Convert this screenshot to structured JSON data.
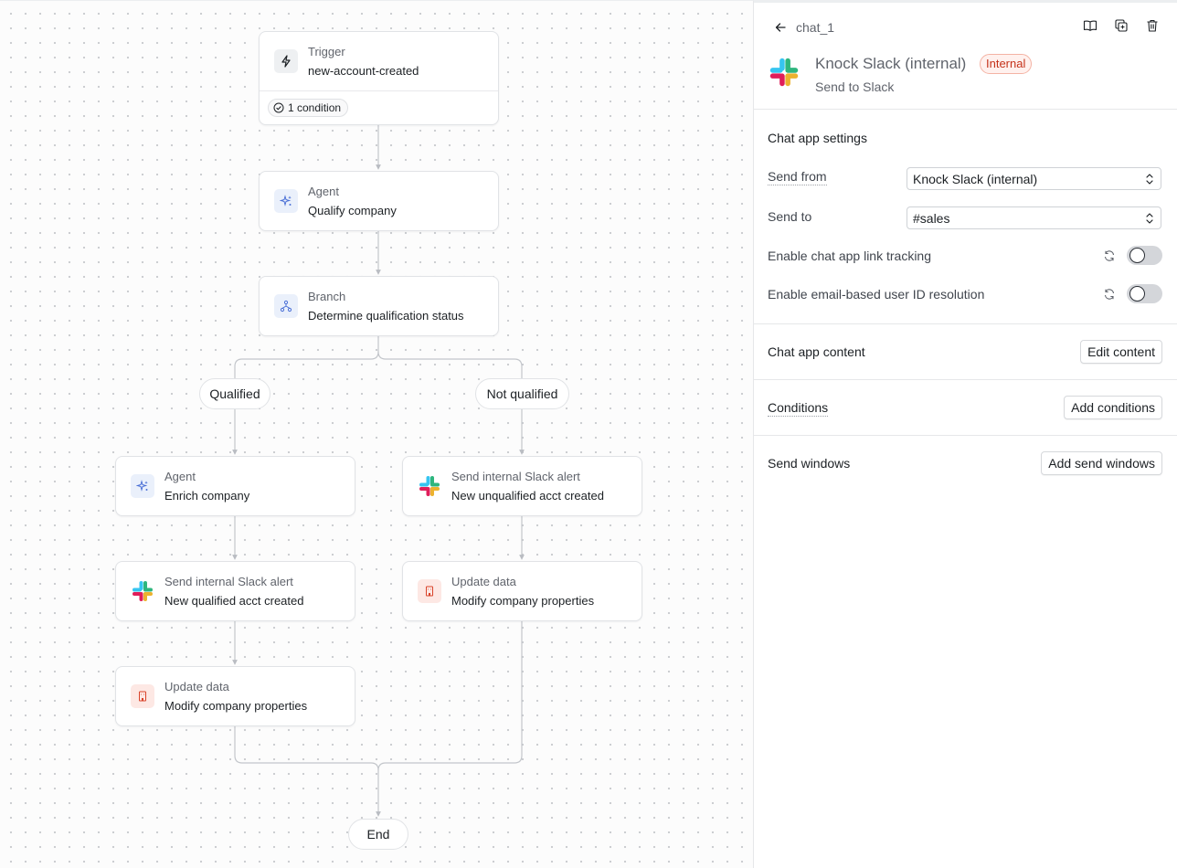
{
  "canvas": {
    "trigger": {
      "kind": "Trigger",
      "title": "new-account-created",
      "condition": "1 condition"
    },
    "agent_qualify": {
      "kind": "Agent",
      "title": "Qualify company"
    },
    "branch": {
      "kind": "Branch",
      "title": "Determine qualification status"
    },
    "branch_labels": {
      "left": "Qualified",
      "right": "Not qualified"
    },
    "agent_enrich": {
      "kind": "Agent",
      "title": "Enrich company"
    },
    "slack_left": {
      "kind": "Send internal Slack alert",
      "title": "New qualified acct created"
    },
    "update_left": {
      "kind": "Update data",
      "title": "Modify company properties"
    },
    "slack_right": {
      "kind": "Send internal Slack alert",
      "title": "New unqualified acct created"
    },
    "update_right": {
      "kind": "Update data",
      "title": "Modify company properties"
    },
    "end": "End"
  },
  "panel": {
    "step_key": "chat_1",
    "channel_name": "Knock Slack (internal)",
    "badge": "Internal",
    "channel_sub": "Send to Slack",
    "settings": {
      "title": "Chat app settings",
      "send_from_label": "Send from",
      "send_from_value": "Knock Slack (internal)",
      "send_to_label": "Send to",
      "send_to_value": "#sales",
      "link_tracking_label": "Enable chat app link tracking",
      "link_tracking_on": false,
      "email_resolution_label": "Enable email-based user ID resolution",
      "email_resolution_on": false
    },
    "content": {
      "title": "Chat app content",
      "button": "Edit content"
    },
    "conditions": {
      "title": "Conditions",
      "button": "Add conditions"
    },
    "windows": {
      "title": "Send windows",
      "button": "Add send windows"
    }
  },
  "colors": {
    "slack_blue": "#36C5F0",
    "slack_green": "#2EB67D",
    "slack_red": "#E01E5A",
    "slack_yellow": "#ECB22E",
    "agent_icon": "#4a6fd6",
    "update_icon": "#d9432a",
    "badge_text": "#c4321a"
  }
}
